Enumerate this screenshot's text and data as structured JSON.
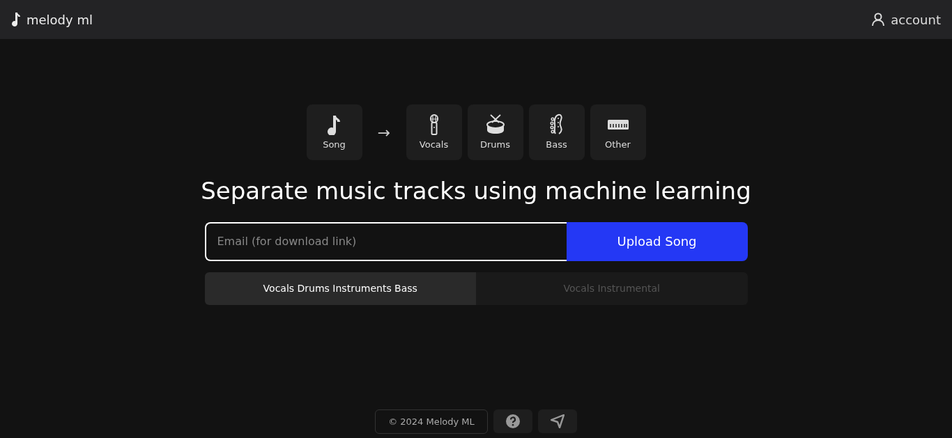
{
  "brand": "melody ml",
  "account": "account",
  "pipeline": {
    "source": {
      "kind": "song",
      "label": "Song"
    },
    "arrow": "→",
    "stems": [
      {
        "kind": "vocals",
        "label": "Vocals"
      },
      {
        "kind": "drums",
        "label": "Drums"
      },
      {
        "kind": "bass",
        "label": "Bass"
      },
      {
        "kind": "other",
        "label": "Other"
      }
    ]
  },
  "headline": "Separate music tracks using machine learning",
  "email": {
    "placeholder": "Email (for download link)"
  },
  "upload_button": "Upload Song",
  "modes": [
    {
      "label": "Vocals Drums Instruments Bass",
      "selected": true
    },
    {
      "label": "Vocals Instrumental",
      "selected": false
    }
  ],
  "footer": {
    "copyright": "© 2024 Melody ML"
  }
}
